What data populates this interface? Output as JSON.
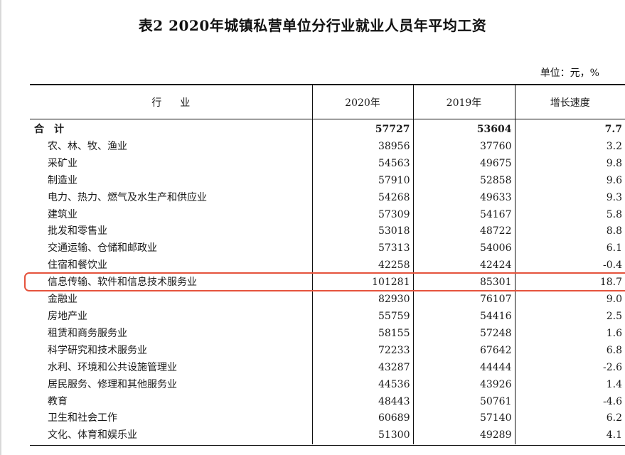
{
  "title": "表2  2020年城镇私营单位分行业就业人员年平均工资",
  "unit": "单位：元，%",
  "headers": [
    "行业",
    "2020年",
    "2019年",
    "增长速度"
  ],
  "total": {
    "industry": "合计",
    "y2020": "57727",
    "y2019": "53604",
    "growth": "7.7"
  },
  "rows": [
    {
      "industry": "农、林、牧、渔业",
      "y2020": "38956",
      "y2019": "37760",
      "growth": "3.2"
    },
    {
      "industry": "采矿业",
      "y2020": "54563",
      "y2019": "49675",
      "growth": "9.8"
    },
    {
      "industry": "制造业",
      "y2020": "57910",
      "y2019": "52858",
      "growth": "9.6"
    },
    {
      "industry": "电力、热力、燃气及水生产和供应业",
      "y2020": "54268",
      "y2019": "49633",
      "growth": "9.3"
    },
    {
      "industry": "建筑业",
      "y2020": "57309",
      "y2019": "54167",
      "growth": "5.8"
    },
    {
      "industry": "批发和零售业",
      "y2020": "53018",
      "y2019": "48722",
      "growth": "8.8"
    },
    {
      "industry": "交通运输、仓储和邮政业",
      "y2020": "57313",
      "y2019": "54006",
      "growth": "6.1"
    },
    {
      "industry": "住宿和餐饮业",
      "y2020": "42258",
      "y2019": "42424",
      "growth": "-0.4"
    },
    {
      "industry": "信息传输、软件和信息技术服务业",
      "y2020": "101281",
      "y2019": "85301",
      "growth": "18.7"
    },
    {
      "industry": "金融业",
      "y2020": "82930",
      "y2019": "76107",
      "growth": "9.0"
    },
    {
      "industry": "房地产业",
      "y2020": "55759",
      "y2019": "54416",
      "growth": "2.5"
    },
    {
      "industry": "租赁和商务服务业",
      "y2020": "58155",
      "y2019": "57248",
      "growth": "1.6"
    },
    {
      "industry": "科学研究和技术服务业",
      "y2020": "72233",
      "y2019": "67642",
      "growth": "6.8"
    },
    {
      "industry": "水利、环境和公共设施管理业",
      "y2020": "43287",
      "y2019": "44444",
      "growth": "-2.6"
    },
    {
      "industry": "居民服务、修理和其他服务业",
      "y2020": "44536",
      "y2019": "43926",
      "growth": "1.4"
    },
    {
      "industry": "教育",
      "y2020": "48443",
      "y2019": "50761",
      "growth": "-4.6"
    },
    {
      "industry": "卫生和社会工作",
      "y2020": "60689",
      "y2019": "57140",
      "growth": "6.2"
    },
    {
      "industry": "文化、体育和娱乐业",
      "y2020": "51300",
      "y2019": "49289",
      "growth": "4.1"
    }
  ],
  "highlight_color": "#e5533d"
}
